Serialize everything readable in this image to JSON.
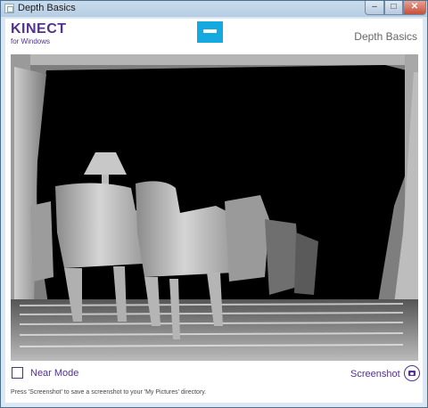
{
  "window": {
    "title": "Depth Basics"
  },
  "header": {
    "logo_brand": "KINECT",
    "logo_sub": "for Windows",
    "title": "Depth Basics",
    "sensor_icon": "kinect-sensor-icon"
  },
  "controls": {
    "near_mode_label": "Near Mode",
    "near_mode_checked": false,
    "screenshot_label": "Screenshot",
    "screenshot_icon": "camera-icon"
  },
  "status_bar": {
    "text": "Press 'Screenshot' to save a screenshot to your 'My Pictures' directory."
  },
  "colors": {
    "brand_purple": "#52318f",
    "sensor_blue": "#14a9e1",
    "close_red": "#c74f38"
  }
}
